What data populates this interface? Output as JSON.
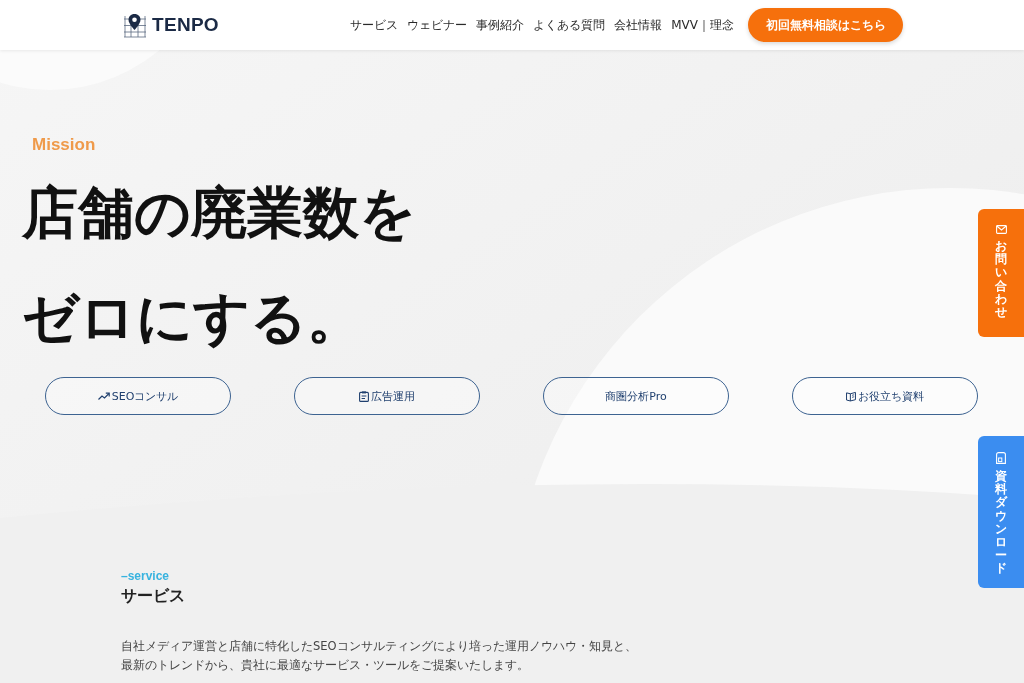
{
  "header": {
    "logo": "TENPO",
    "nav": [
      "サービス",
      "ウェビナー",
      "事例紹介",
      "よくある質問",
      "会社情報",
      "MVV｜理念"
    ],
    "cta": "初回無料相談はこちら"
  },
  "hero": {
    "eyebrow": "Mission",
    "headline": [
      "店舗の廃業数を",
      "ゼロにする。"
    ],
    "links": [
      {
        "label": "SEOコンサル",
        "kind": "trend"
      },
      {
        "label": "広告運用",
        "kind": "memo"
      },
      {
        "label": "商圏分析Pro",
        "kind": "plain"
      },
      {
        "label": "お役立ち資料",
        "kind": "book"
      }
    ]
  },
  "side_tabs": [
    {
      "label": "お問い合わせ",
      "kind": "contact"
    },
    {
      "label": "資料ダウンロード",
      "kind": "download"
    }
  ],
  "service": {
    "eyebrow": "–service",
    "title": "サービス",
    "description": [
      "自社メディア運営と店舗に特化したSEOコンサルティングにより培った運用ノウハウ・知見と、",
      "最新のトレンドから、貴社に最適なサービス・ツールをご提案いたします。"
    ]
  }
}
